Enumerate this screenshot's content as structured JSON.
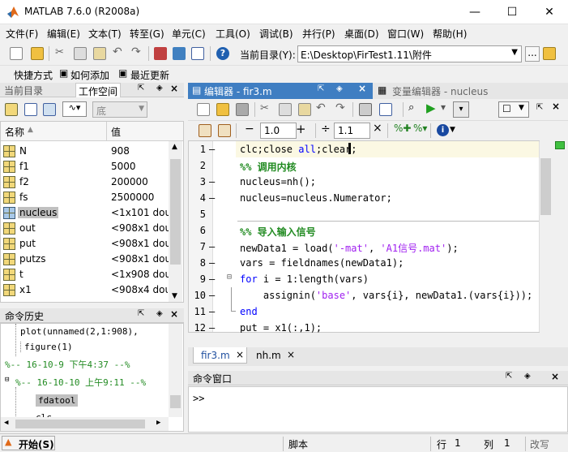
{
  "window": {
    "title": "MATLAB  7.6.0 (R2008a)",
    "minimize": "—",
    "maximize": "☐",
    "close": "✕"
  },
  "menu": [
    "文件(F)",
    "编辑(E)",
    "文本(T)",
    "转至(G)",
    "单元(C)",
    "工具(O)",
    "调试(B)",
    "并行(P)",
    "桌面(D)",
    "窗口(W)",
    "帮助(H)"
  ],
  "toolbar": {
    "current_dir_label": "当前目录(Y):",
    "current_dir_value": "E:\\Desktop\\FirTest1.11\\附件",
    "browse": "..."
  },
  "shortcuts": {
    "label": "快捷方式",
    "how_to_add": "如何添加",
    "whats_new": "最近更新"
  },
  "left_tabs": {
    "current_dir": "当前目录",
    "workspace": "工作空间"
  },
  "workspace": {
    "stack_value": "底",
    "col_name": "名称",
    "col_value": "值",
    "rows": [
      {
        "name": "N",
        "value": "908"
      },
      {
        "name": "f1",
        "value": "5000"
      },
      {
        "name": "f2",
        "value": "200000"
      },
      {
        "name": "fs",
        "value": "2500000"
      },
      {
        "name": "nucleus",
        "value": "<1x101 dou"
      },
      {
        "name": "out",
        "value": "<908x1 dou"
      },
      {
        "name": "put",
        "value": "<908x1 dou"
      },
      {
        "name": "putzs",
        "value": "<908x1 dou"
      },
      {
        "name": "t",
        "value": "<1x908 dou"
      },
      {
        "name": "x1",
        "value": "<908x4 dou"
      }
    ]
  },
  "history": {
    "title": "命令历史",
    "items": [
      "plot(unnamed(2,1:908),",
      "figure(1)",
      "%-- 16-10-9 下午4:37 --%",
      "%-- 16-10-10 上午9:11 --%",
      "fdatool",
      "clc"
    ]
  },
  "editor": {
    "title": "编辑器 - fir3.m",
    "var_editor_title": "变量编辑器 - nucleus",
    "zoom1": "1.0",
    "zoom2": "1.1",
    "lines": [
      {
        "n": "1",
        "dash": "—"
      },
      {
        "n": "2",
        "dash": ""
      },
      {
        "n": "3",
        "dash": "—"
      },
      {
        "n": "4",
        "dash": "—"
      },
      {
        "n": "5",
        "dash": ""
      },
      {
        "n": "6",
        "dash": ""
      },
      {
        "n": "7",
        "dash": "—"
      },
      {
        "n": "8",
        "dash": "—"
      },
      {
        "n": "9",
        "dash": "—"
      },
      {
        "n": "10",
        "dash": "—"
      },
      {
        "n": "11",
        "dash": "—"
      },
      {
        "n": "12",
        "dash": "—"
      }
    ],
    "code": {
      "l1a": "clc;close ",
      "l1b": "all",
      "l1c": ";clear;",
      "l2": "%% 调用内核",
      "l3": "nucleus=nh();",
      "l4": "nucleus=nucleus.Numerator;",
      "l6": "%% 导入输入信号",
      "l7a": "newData1 = load(",
      "l7b": "'-mat'",
      "l7c": ", ",
      "l7d": "'A1信号.mat'",
      "l7e": ");",
      "l8": "vars = fieldnames(newData1);",
      "l9a": "for",
      "l9b": " i = 1:length(vars)",
      "l10a": "    assignin(",
      "l10b": "'base'",
      "l10c": ", vars{i}, newData1.(vars{i}));",
      "l11": "end",
      "l12": "put = x1(:,1);"
    },
    "tabs": [
      "fir3.m",
      "nh.m"
    ]
  },
  "command_window": {
    "title": "命令窗口",
    "prompt": ">>"
  },
  "status": {
    "start": "开始(S)",
    "mode": "脚本",
    "row_label": "行",
    "row": "1",
    "col_label": "列",
    "col": "1",
    "ovr": "改写"
  }
}
